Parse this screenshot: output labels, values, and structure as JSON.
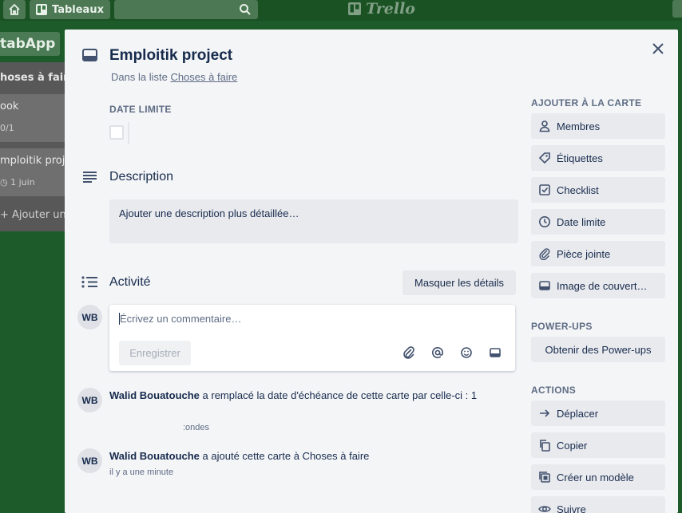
{
  "topbar": {
    "boards_label": "Tableaux",
    "logo_text": "Trello"
  },
  "board": {
    "name": "tabApp"
  },
  "list": {
    "title": "hoses à faire",
    "cards": [
      {
        "title": "ook",
        "badge": "0/1"
      },
      {
        "title": "mploitik projec",
        "badge": "1 juin"
      }
    ],
    "add_label": "Ajouter une"
  },
  "modal": {
    "title": "Emploitik project",
    "in_list_prefix": "Dans la liste",
    "in_list_link": "Choses à faire",
    "due_label": "DATE LIMITE",
    "description": {
      "heading": "Description",
      "placeholder": "Ajouter une description plus détaillée…"
    },
    "activity": {
      "heading": "Activité",
      "hide_details": "Masquer les détails",
      "avatar": "WB",
      "comment_placeholder": "Écrivez un commentaire…",
      "save_label": "Enregistrer",
      "entries": [
        {
          "avatar": "WB",
          "user": "Walid Bouatouche",
          "text": "a remplacé la date d'échéance de cette carte par celle-ci : 1",
          "time": ":ondes"
        },
        {
          "avatar": "WB",
          "user": "Walid Bouatouche",
          "text": "a ajouté cette carte à Choses à faire",
          "time": "il y a une minute"
        }
      ]
    },
    "sidebar": {
      "add_heading": "AJOUTER À LA CARTE",
      "add_items": [
        {
          "label": "Membres",
          "icon": "person-icon"
        },
        {
          "label": "Étiquettes",
          "icon": "tag-icon"
        },
        {
          "label": "Checklist",
          "icon": "checkbox-icon"
        },
        {
          "label": "Date limite",
          "icon": "clock-icon"
        },
        {
          "label": "Pièce jointe",
          "icon": "paperclip-icon"
        },
        {
          "label": "Image de couvert…",
          "icon": "card-cover-icon"
        }
      ],
      "powerups_heading": "POWER-UPS",
      "powerups_button": "Obtenir des Power-ups",
      "actions_heading": "ACTIONS",
      "actions": [
        {
          "label": "Déplacer",
          "icon": "arrow-right-icon"
        },
        {
          "label": "Copier",
          "icon": "copy-icon"
        },
        {
          "label": "Créer un modèle",
          "icon": "template-icon"
        },
        {
          "label": "Suivre",
          "icon": "eye-icon"
        }
      ]
    }
  }
}
